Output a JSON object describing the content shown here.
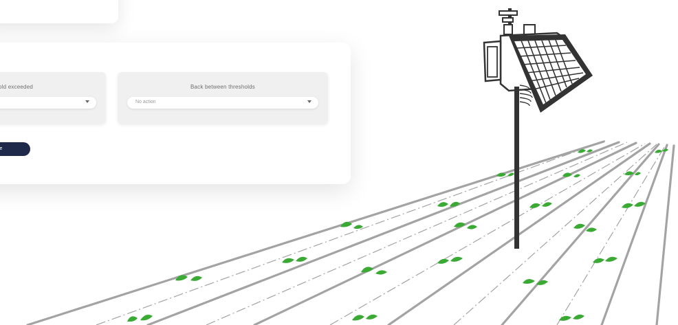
{
  "top_card": {},
  "thresholds": {
    "exceeded_label": "old exceeded",
    "exceeded_value": "",
    "between_label": "Back between thresholds",
    "between_value": "No action"
  },
  "save_button": {
    "label": "ve"
  },
  "icons": {
    "select_caret": "chevron-down-icon",
    "illustration": "weather-station-solar-panel"
  },
  "colors": {
    "button": "#1f2a4a",
    "sprout": "#3aaa35",
    "row_line": "#a3a3a3",
    "station": "#333333"
  }
}
